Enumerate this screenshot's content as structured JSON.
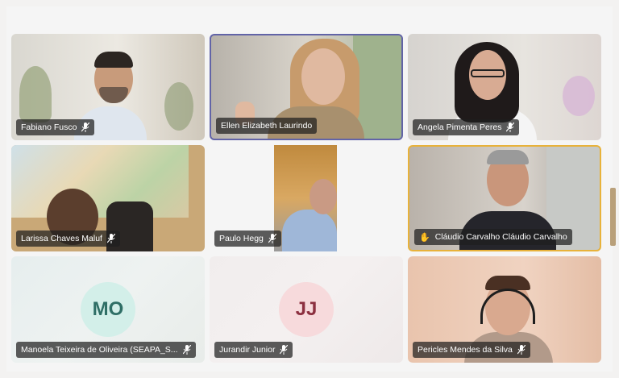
{
  "participants": [
    {
      "name": "Fabiano Fusco",
      "muted": true
    },
    {
      "name": "Ellen Elizabeth Laurindo",
      "muted": false
    },
    {
      "name": "Angela Pimenta Peres",
      "muted": true
    },
    {
      "name": "Larissa Chaves Maluf",
      "muted": true
    },
    {
      "name": "Paulo Hegg",
      "muted": true
    },
    {
      "name": "Cláudio Carvalho Cláudio Carvalho",
      "muted": false,
      "hand_raised": true
    },
    {
      "name": "Manoela Teixeira de Oliveira (SEAPA_S...",
      "muted": true,
      "initials": "MO"
    },
    {
      "name": "Jurandir Junior",
      "muted": true,
      "initials": "JJ"
    },
    {
      "name": "Pericles Mendes da Silva",
      "muted": true
    }
  ],
  "colors": {
    "speaking_border": "#6264a7",
    "hand_border": "#e8b23a",
    "avatar_mo_bg": "#d3efe9",
    "avatar_mo_fg": "#2f6f66",
    "avatar_jj_bg": "#f7dadc",
    "avatar_jj_fg": "#8c3040"
  }
}
